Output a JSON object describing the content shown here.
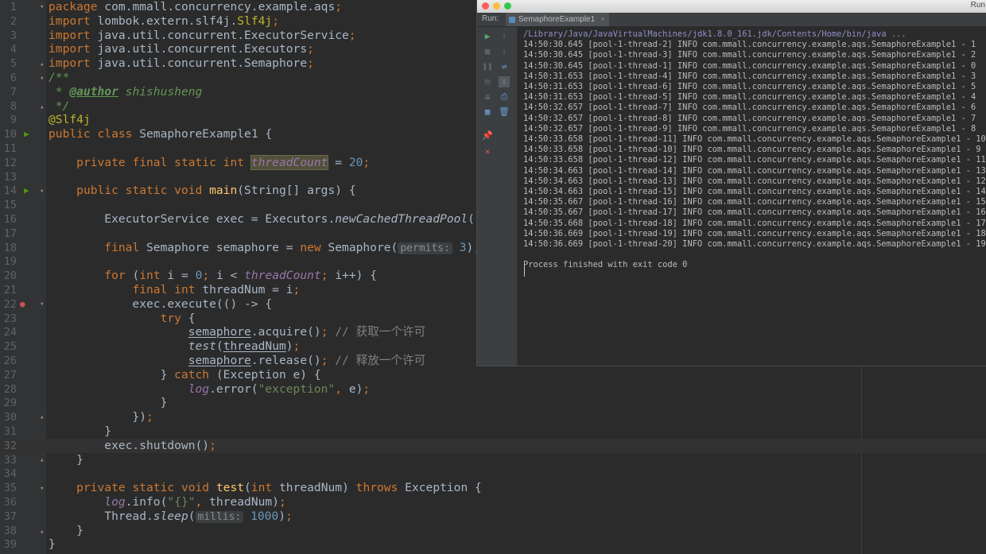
{
  "editor": {
    "lines": [
      {
        "n": "1",
        "segs": [
          [
            "kw",
            "package "
          ],
          [
            "p",
            "com.mmall.concurrency.example.aqs"
          ],
          [
            "kw",
            ";"
          ]
        ]
      },
      {
        "n": "2",
        "segs": [
          [
            "kw",
            "import "
          ],
          [
            "p",
            "lombok.extern.slf4j."
          ],
          [
            "ann",
            "Slf4j"
          ],
          [
            "kw",
            ";"
          ]
        ]
      },
      {
        "n": "3",
        "segs": [
          [
            "kw",
            "import "
          ],
          [
            "p",
            "java.util.concurrent.ExecutorService"
          ],
          [
            "kw",
            ";"
          ]
        ]
      },
      {
        "n": "4",
        "segs": [
          [
            "kw",
            "import "
          ],
          [
            "p",
            "java.util.concurrent.Executors"
          ],
          [
            "kw",
            ";"
          ]
        ]
      },
      {
        "n": "5",
        "segs": [
          [
            "kw",
            "import "
          ],
          [
            "p",
            "java.util.concurrent.Semaphore"
          ],
          [
            "kw",
            ";"
          ]
        ]
      },
      {
        "n": "6",
        "segs": [
          [
            "doc",
            "/**"
          ]
        ]
      },
      {
        "n": "7",
        "segs": [
          [
            "doc",
            " * "
          ],
          [
            "doctag",
            "@author"
          ],
          [
            "doc",
            " shishusheng"
          ]
        ]
      },
      {
        "n": "8",
        "segs": [
          [
            "doc",
            " */"
          ]
        ]
      },
      {
        "n": "9",
        "segs": [
          [
            "ann",
            "@Slf4j"
          ]
        ]
      },
      {
        "n": "10",
        "segs": [
          [
            "kw",
            "public class "
          ],
          [
            "p",
            "SemaphoreExample1 {"
          ]
        ]
      },
      {
        "n": "11",
        "segs": []
      },
      {
        "n": "12",
        "segs": [
          [
            "p",
            "    "
          ],
          [
            "kw",
            "private final static int "
          ],
          [
            "sfield-hl",
            "threadCount"
          ],
          [
            "p",
            " = "
          ],
          [
            "num",
            "20"
          ],
          [
            "kw",
            ";"
          ]
        ]
      },
      {
        "n": "13",
        "segs": []
      },
      {
        "n": "14",
        "segs": [
          [
            "p",
            "    "
          ],
          [
            "kw",
            "public static void "
          ],
          [
            "fn",
            "main"
          ],
          [
            "p",
            "(String[] args) {"
          ]
        ]
      },
      {
        "n": "15",
        "segs": []
      },
      {
        "n": "16",
        "segs": [
          [
            "p",
            "        ExecutorService exec = Executors."
          ],
          [
            "smethod",
            "newCachedThreadPool"
          ],
          [
            "p",
            "()"
          ],
          [
            "kw",
            ";"
          ]
        ]
      },
      {
        "n": "17",
        "segs": []
      },
      {
        "n": "18",
        "segs": [
          [
            "p",
            "        "
          ],
          [
            "kw",
            "final "
          ],
          [
            "p",
            "Semaphore semaphore = "
          ],
          [
            "kw",
            "new "
          ],
          [
            "p",
            "Semaphore("
          ],
          [
            "hint",
            "permits:"
          ],
          [
            "num",
            " 3"
          ],
          [
            "p",
            ")"
          ],
          [
            "kw",
            ";"
          ]
        ]
      },
      {
        "n": "19",
        "segs": []
      },
      {
        "n": "20",
        "segs": [
          [
            "p",
            "        "
          ],
          [
            "kw",
            "for "
          ],
          [
            "p",
            "("
          ],
          [
            "kw",
            "int "
          ],
          [
            "p",
            "i = "
          ],
          [
            "num",
            "0"
          ],
          [
            "kw",
            "; "
          ],
          [
            "p",
            "i < "
          ],
          [
            "sfield",
            "threadCount"
          ],
          [
            "kw",
            "; "
          ],
          [
            "p",
            "i++) {"
          ]
        ]
      },
      {
        "n": "21",
        "segs": [
          [
            "p",
            "            "
          ],
          [
            "kw",
            "final int "
          ],
          [
            "p",
            "threadNum = i"
          ],
          [
            "kw",
            ";"
          ]
        ]
      },
      {
        "n": "22",
        "segs": [
          [
            "p",
            "            exec.execute(() -> {"
          ]
        ]
      },
      {
        "n": "23",
        "segs": [
          [
            "p",
            "                "
          ],
          [
            "kw",
            "try "
          ],
          [
            "p",
            "{"
          ]
        ]
      },
      {
        "n": "24",
        "segs": [
          [
            "p",
            "                    "
          ],
          [
            "capt",
            "semaphore"
          ],
          [
            "p",
            ".acquire()"
          ],
          [
            "kw",
            "; "
          ],
          [
            "cmt",
            "// 获取一个许可"
          ]
        ]
      },
      {
        "n": "25",
        "segs": [
          [
            "p",
            "                    "
          ],
          [
            "smethod",
            "test"
          ],
          [
            "p",
            "("
          ],
          [
            "capt",
            "threadNum"
          ],
          [
            "p",
            ")"
          ],
          [
            "kw",
            ";"
          ]
        ]
      },
      {
        "n": "26",
        "segs": [
          [
            "p",
            "                    "
          ],
          [
            "capt",
            "semaphore"
          ],
          [
            "p",
            ".release()"
          ],
          [
            "kw",
            "; "
          ],
          [
            "cmt",
            "// 释放一个许可"
          ]
        ]
      },
      {
        "n": "27",
        "segs": [
          [
            "p",
            "                } "
          ],
          [
            "kw",
            "catch "
          ],
          [
            "p",
            "(Exception e) {"
          ]
        ]
      },
      {
        "n": "28",
        "segs": [
          [
            "p",
            "                    "
          ],
          [
            "sfield",
            "log"
          ],
          [
            "p",
            ".error("
          ],
          [
            "str",
            "\"exception\""
          ],
          [
            "kw",
            ", "
          ],
          [
            "p",
            "e)"
          ],
          [
            "kw",
            ";"
          ]
        ]
      },
      {
        "n": "29",
        "segs": [
          [
            "p",
            "                }"
          ]
        ]
      },
      {
        "n": "30",
        "segs": [
          [
            "p",
            "            })"
          ],
          [
            "kw",
            ";"
          ]
        ]
      },
      {
        "n": "31",
        "segs": [
          [
            "p",
            "        }"
          ]
        ]
      },
      {
        "n": "32",
        "segs": [
          [
            "p",
            "        exec.shutdown()"
          ],
          [
            "kw",
            ";"
          ]
        ]
      },
      {
        "n": "33",
        "segs": [
          [
            "p",
            "    }"
          ]
        ]
      },
      {
        "n": "34",
        "segs": []
      },
      {
        "n": "35",
        "segs": [
          [
            "p",
            "    "
          ],
          [
            "kw",
            "private static void "
          ],
          [
            "fn",
            "test"
          ],
          [
            "p",
            "("
          ],
          [
            "kw",
            "int "
          ],
          [
            "p",
            "threadNum) "
          ],
          [
            "kw",
            "throws "
          ],
          [
            "p",
            "Exception {"
          ]
        ]
      },
      {
        "n": "36",
        "segs": [
          [
            "p",
            "        "
          ],
          [
            "sfield",
            "log"
          ],
          [
            "p",
            ".info("
          ],
          [
            "str",
            "\"{}\""
          ],
          [
            "kw",
            ", "
          ],
          [
            "p",
            "threadNum)"
          ],
          [
            "kw",
            ";"
          ]
        ]
      },
      {
        "n": "37",
        "segs": [
          [
            "p",
            "        Thread."
          ],
          [
            "smethod",
            "sleep"
          ],
          [
            "p",
            "("
          ],
          [
            "hint",
            "millis:"
          ],
          [
            "num",
            " 1000"
          ],
          [
            "p",
            ")"
          ],
          [
            "kw",
            ";"
          ]
        ]
      },
      {
        "n": "38",
        "segs": [
          [
            "p",
            "    }"
          ]
        ]
      },
      {
        "n": "39",
        "segs": [
          [
            "p",
            "}"
          ]
        ]
      }
    ]
  },
  "run_window": {
    "title": "Run",
    "run_label": "Run:",
    "tab_label": "SemaphoreExample1",
    "console_lines": [
      "/Library/Java/JavaVirtualMachines/jdk1.8.0_161.jdk/Contents/Home/bin/java ...",
      "14:50:30.645 [pool-1-thread-2] INFO com.mmall.concurrency.example.aqs.SemaphoreExample1 - 1",
      "14:50:30.645 [pool-1-thread-3] INFO com.mmall.concurrency.example.aqs.SemaphoreExample1 - 2",
      "14:50:30.645 [pool-1-thread-1] INFO com.mmall.concurrency.example.aqs.SemaphoreExample1 - 0",
      "14:50:31.653 [pool-1-thread-4] INFO com.mmall.concurrency.example.aqs.SemaphoreExample1 - 3",
      "14:50:31.653 [pool-1-thread-6] INFO com.mmall.concurrency.example.aqs.SemaphoreExample1 - 5",
      "14:50:31.653 [pool-1-thread-5] INFO com.mmall.concurrency.example.aqs.SemaphoreExample1 - 4",
      "14:50:32.657 [pool-1-thread-7] INFO com.mmall.concurrency.example.aqs.SemaphoreExample1 - 6",
      "14:50:32.657 [pool-1-thread-8] INFO com.mmall.concurrency.example.aqs.SemaphoreExample1 - 7",
      "14:50:32.657 [pool-1-thread-9] INFO com.mmall.concurrency.example.aqs.SemaphoreExample1 - 8",
      "14:50:33.658 [pool-1-thread-11] INFO com.mmall.concurrency.example.aqs.SemaphoreExample1 - 10",
      "14:50:33.658 [pool-1-thread-10] INFO com.mmall.concurrency.example.aqs.SemaphoreExample1 - 9",
      "14:50:33.658 [pool-1-thread-12] INFO com.mmall.concurrency.example.aqs.SemaphoreExample1 - 11",
      "14:50:34.663 [pool-1-thread-14] INFO com.mmall.concurrency.example.aqs.SemaphoreExample1 - 13",
      "14:50:34.663 [pool-1-thread-13] INFO com.mmall.concurrency.example.aqs.SemaphoreExample1 - 12",
      "14:50:34.663 [pool-1-thread-15] INFO com.mmall.concurrency.example.aqs.SemaphoreExample1 - 14",
      "14:50:35.667 [pool-1-thread-16] INFO com.mmall.concurrency.example.aqs.SemaphoreExample1 - 15",
      "14:50:35.667 [pool-1-thread-17] INFO com.mmall.concurrency.example.aqs.SemaphoreExample1 - 16",
      "14:50:35.668 [pool-1-thread-18] INFO com.mmall.concurrency.example.aqs.SemaphoreExample1 - 17",
      "14:50:36.669 [pool-1-thread-19] INFO com.mmall.concurrency.example.aqs.SemaphoreExample1 - 18",
      "14:50:36.669 [pool-1-thread-20] INFO com.mmall.concurrency.example.aqs.SemaphoreExample1 - 19",
      "",
      "Process finished with exit code 0"
    ]
  },
  "icons": {
    "rerun": "play-icon",
    "stop": "stop-icon",
    "pause": "pause-icon",
    "close": "close-icon"
  },
  "colors": {
    "editor_bg": "#2b2b2b",
    "keyword": "#cc7832",
    "string": "#6a8759",
    "number": "#6897bb",
    "annotation": "#bbb529"
  }
}
